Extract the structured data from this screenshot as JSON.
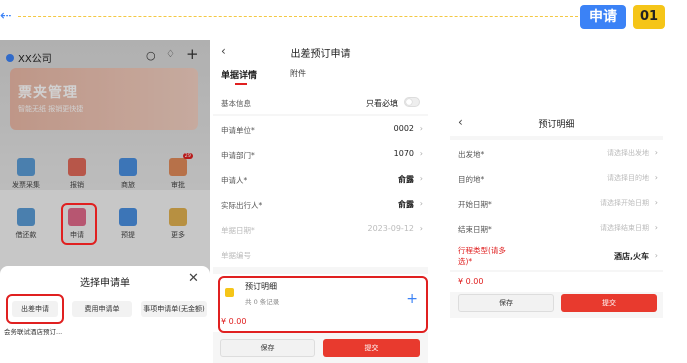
{
  "header": {
    "tag_blue": "申请",
    "tag_yellow": "01"
  },
  "panel1": {
    "company": "XX公司",
    "banner_title": "票夹管理",
    "banner_sub": "智能无纸 报销更快捷",
    "grid": [
      {
        "label": "发票采集"
      },
      {
        "label": "报销"
      },
      {
        "label": "商旅"
      },
      {
        "label": "审批"
      },
      {
        "label": "借还款"
      },
      {
        "label": "申请"
      },
      {
        "label": "预提"
      },
      {
        "label": "更多"
      }
    ],
    "badge": "29",
    "sheet_title": "选择申请单",
    "options": [
      "出差申请",
      "费用申请单",
      "事项申请单(无金额)",
      "会务联试酒店预订..."
    ]
  },
  "panel2": {
    "title": "出差预订申请",
    "tab_active": "单据详情",
    "tab2": "附件",
    "basic_info": "基本信息",
    "only_required": "只看必填",
    "rows": [
      {
        "label": "申请单位*",
        "value": "0002"
      },
      {
        "label": "申请部门*",
        "value": "1070"
      },
      {
        "label": "申请人*",
        "value": "俞露"
      },
      {
        "label": "实际出行人*",
        "value": "俞露"
      },
      {
        "label": "单据日期*",
        "value": "2023-09-12"
      },
      {
        "label": "单据编号",
        "value": ""
      }
    ],
    "detail_title": "预订明细",
    "detail_count": "共 0 条记录",
    "amount": "¥ 0.00",
    "save": "保存",
    "submit": "提交"
  },
  "panel3": {
    "title": "预订明细",
    "rows": [
      {
        "label": "出发地*",
        "value": "请选择出发地"
      },
      {
        "label": "目的地*",
        "value": "请选择目的地"
      },
      {
        "label": "开始日期*",
        "value": "请选择开始日期"
      },
      {
        "label": "结束日期*",
        "value": "请选择结束日期"
      }
    ],
    "type_label": "行程类型(请多选)*",
    "type_value": "酒店,火车",
    "amount": "¥ 0.00",
    "save": "保存",
    "submit": "提交"
  },
  "colors": {
    "accent_blue": "#3b82f6",
    "accent_red": "#e02020",
    "tag_yellow": "#f5c518"
  }
}
